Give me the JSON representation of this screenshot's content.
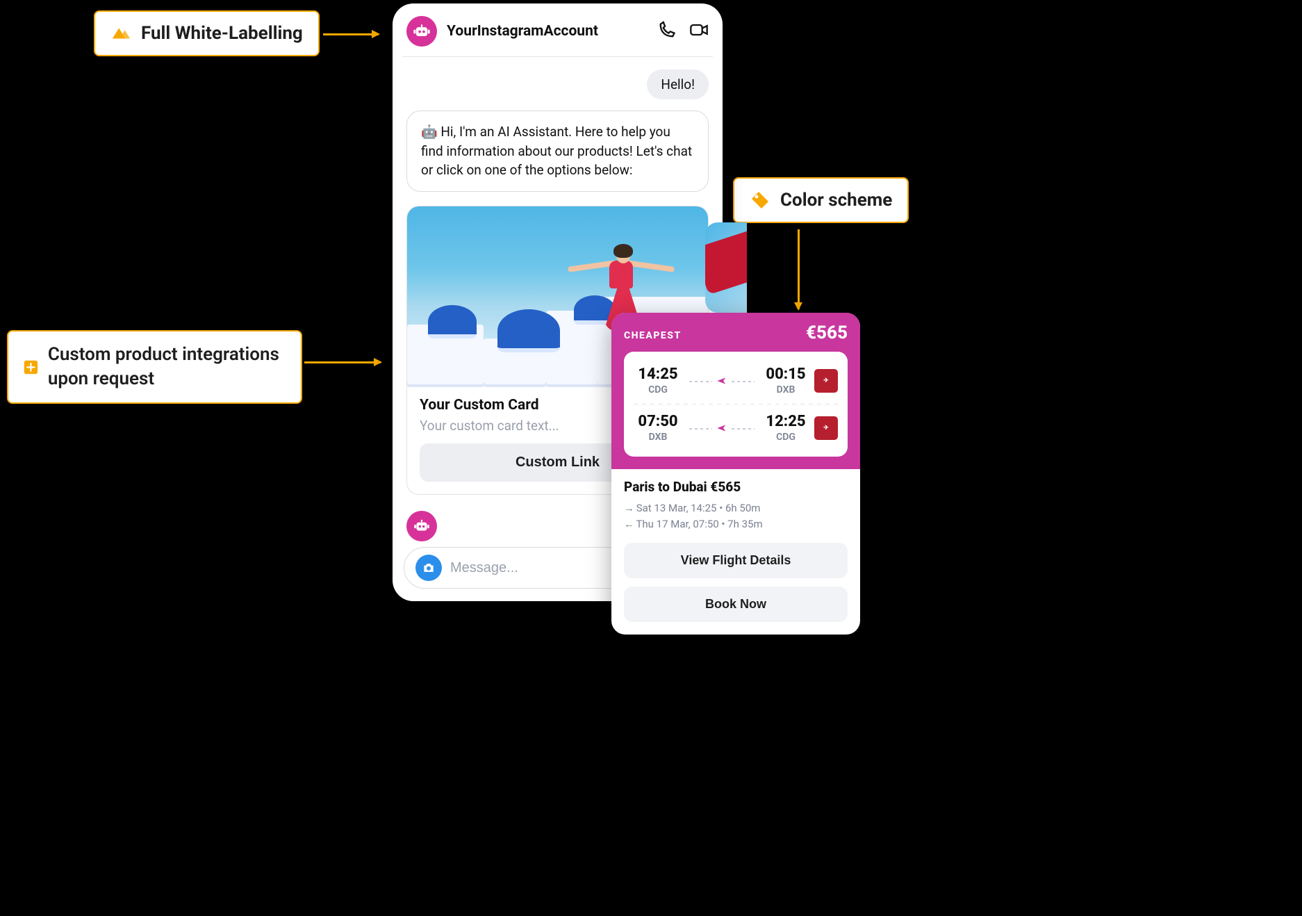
{
  "callouts": {
    "whiteLabel": "Full White-Labelling",
    "custom": "Custom product integrations upon request",
    "colorScheme": "Color scheme"
  },
  "chat": {
    "account": "YourInstagramAccount",
    "userMsg": "Hello!",
    "botMsg": "🤖 Hi, I'm an AI Assistant. Here to help you find information about our products! Let's chat or click on one of the options below:",
    "composerPlaceholder": "Message..."
  },
  "card": {
    "title": "Your Custom Card",
    "subtitle": "Your custom card text...",
    "button": "Custom Link"
  },
  "flight": {
    "badge": "CHEAPEST",
    "currency": "€",
    "price": "565",
    "legs": [
      {
        "depTime": "14:25",
        "depCode": "CDG",
        "arrTime": "00:15",
        "arrCode": "DXB"
      },
      {
        "depTime": "07:50",
        "depCode": "DXB",
        "arrTime": "12:25",
        "arrCode": "CDG"
      }
    ],
    "route": "Paris to Dubai €565",
    "outbound": "Sat 13 Mar, 14:25 • 6h 50m",
    "inbound": "Thu 17 Mar, 07:50 • 7h 35m",
    "btnDetails": "View Flight Details",
    "btnBook": "Book Now"
  }
}
